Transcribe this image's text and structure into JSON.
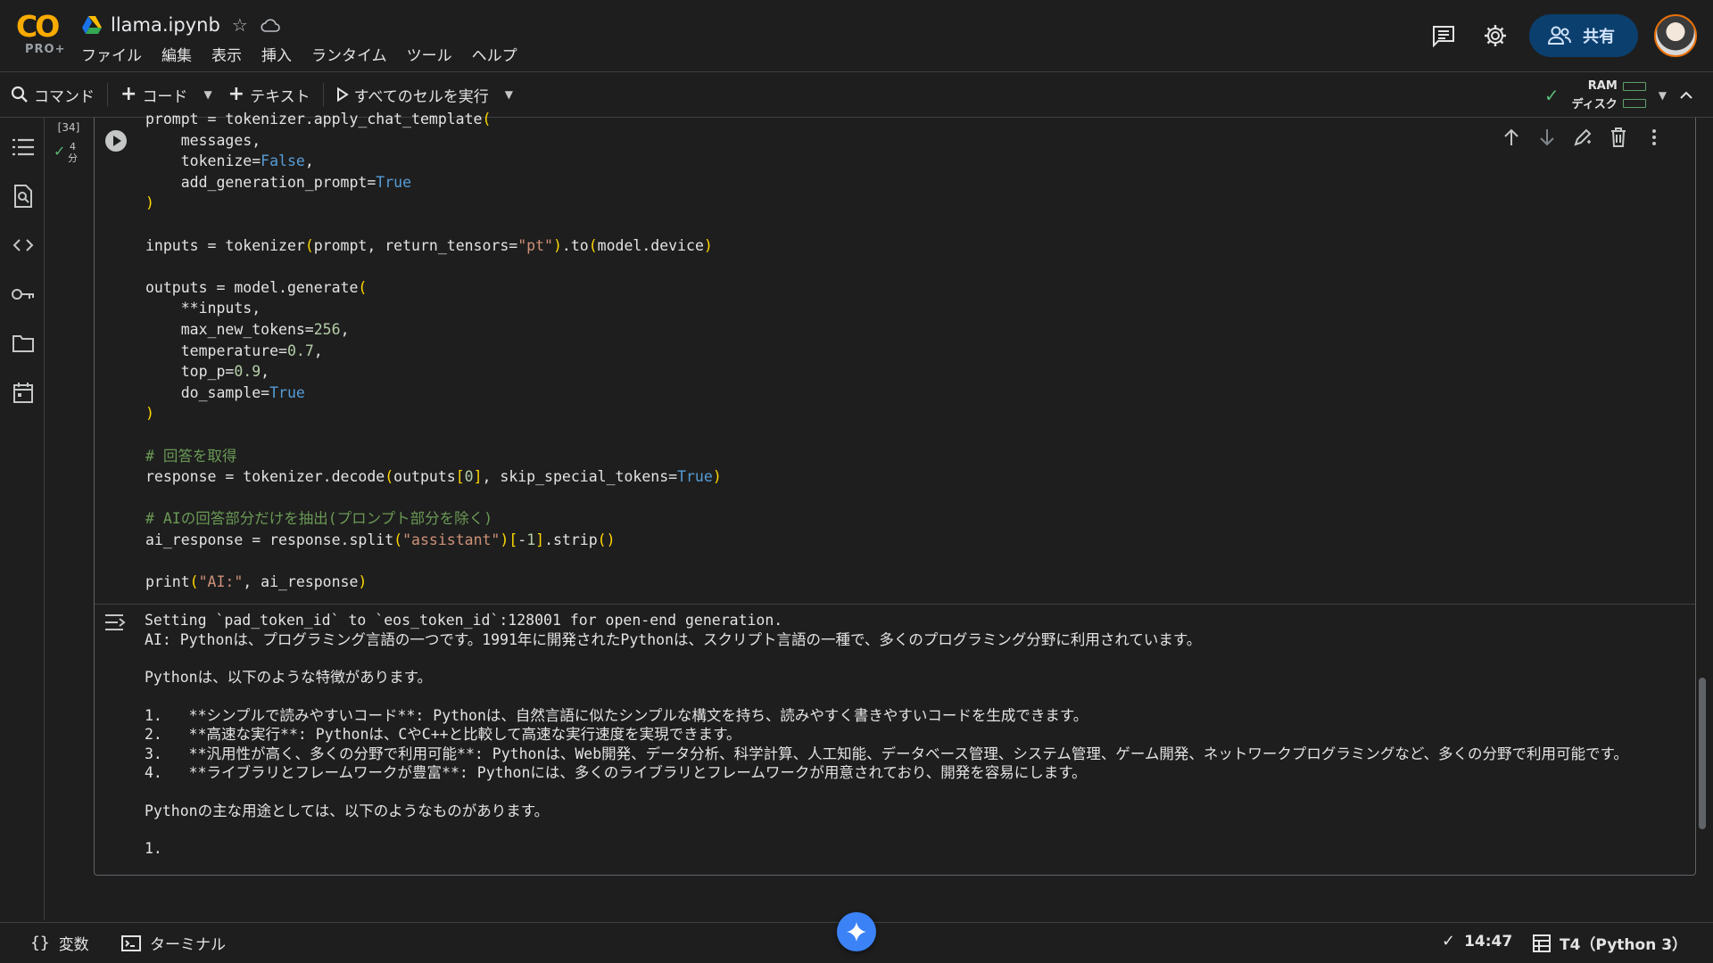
{
  "app": {
    "logo_text": "CO",
    "logo_badge": "PRO+",
    "file_title": "llama.ipynb"
  },
  "menu": [
    "ファイル",
    "編集",
    "表示",
    "挿入",
    "ランタイム",
    "ツール",
    "ヘルプ"
  ],
  "header": {
    "share_label": "共有"
  },
  "toolbar": {
    "command_label": "コマンド",
    "code_label": "コード",
    "text_label": "テキスト",
    "run_all_label": "すべてのセルを実行",
    "ram_label": "RAM",
    "disk_label": "ディスク"
  },
  "cell": {
    "exec_count": "[34]",
    "exec_time_value": "4",
    "exec_time_unit": "分",
    "code_lines": [
      "prompt = tokenizer.apply_chat_template(",
      "    messages,",
      "    tokenize=False,",
      "    add_generation_prompt=True",
      ")",
      "",
      "inputs = tokenizer(prompt, return_tensors=\"pt\").to(model.device)",
      "",
      "outputs = model.generate(",
      "    **inputs,",
      "    max_new_tokens=256,",
      "    temperature=0.7,",
      "    top_p=0.9,",
      "    do_sample=True",
      ")",
      "",
      "# 回答を取得",
      "response = tokenizer.decode(outputs[0], skip_special_tokens=True)",
      "",
      "# AIの回答部分だけを抽出(プロンプト部分を除く)",
      "ai_response = response.split(\"assistant\")[-1].strip()",
      "",
      "print(\"AI:\", ai_response)"
    ],
    "output_lines": [
      "Setting `pad_token_id` to `eos_token_id`:128001 for open-end generation.",
      "AI: Pythonは、プログラミング言語の一つです。1991年に開発されたPythonは、スクリプト言語の一種で、多くのプログラミング分野に利用されています。",
      "",
      "Pythonは、以下のような特徴があります。",
      "",
      "1.   **シンプルで読みやすいコード**: Pythonは、自然言語に似たシンプルな構文を持ち、読みやすく書きやすいコードを生成できます。",
      "2.   **高速な実行**: Pythonは、CやC++と比較して高速な実行速度を実現できます。",
      "3.   **汎用性が高く、多くの分野で利用可能**: Pythonは、Web開発、データ分析、科学計算、人工知能、データベース管理、システム管理、ゲーム開発、ネットワークプログラミングなど、多くの分野で利用可能です。",
      "4.   **ライブラリとフレームワークが豊富**: Pythonには、多くのライブラリとフレームワークが用意されており、開発を容易にします。",
      "",
      "Pythonの主な用途としては、以下のようなものがあります。",
      "",
      "1."
    ]
  },
  "statusbar": {
    "variables_label": "変数",
    "terminal_label": "ターミナル",
    "time": "14:47",
    "runtime": "T4（Python 3）"
  },
  "colors": {
    "accent_orange": "#f9ab00",
    "share_bg": "#0b3f6e",
    "ok_green": "#5bb974",
    "gemini_blue": "#3b82f6"
  },
  "icons": [
    "drive-icon",
    "star-icon",
    "cloud-icon",
    "comment-icon",
    "gear-icon",
    "share-people-icon",
    "search-icon",
    "play-icon",
    "check-icon",
    "toc-icon",
    "find-icon",
    "code-icon",
    "key-icon",
    "folder-icon",
    "calendar-icon",
    "arrow-up-icon",
    "arrow-down-icon",
    "edit-icon",
    "trash-icon",
    "more-vert-icon",
    "output-icon",
    "braces-icon",
    "terminal-icon",
    "gemini-icon",
    "chevron-up-icon"
  ]
}
